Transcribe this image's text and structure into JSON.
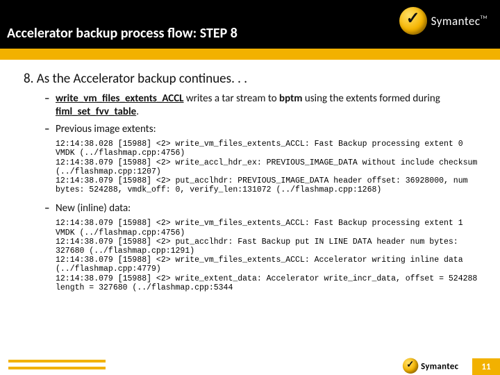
{
  "header": {
    "title": "Accelerator backup process flow: STEP 8",
    "brand": "Symantec",
    "tm": "TM"
  },
  "content": {
    "heading_no": "8.",
    "heading_txt": "As the Accelerator backup continues. . .",
    "b1_code1": "write_vm_files_extents_ACCL",
    "b1_mid1": " writes a tar stream to ",
    "b1_code2": "bptm",
    "b1_mid2": " using the extents formed during ",
    "b1_code3": "fiml_set_fvv_table",
    "b1_end": ".",
    "b2": "Previous image extents:",
    "log1": "12:14:38.028 [15988] <2> write_vm_files_extents_ACCL: Fast Backup processing extent 0 VMDK (../flashmap.cpp:4756)\n12:14:38.079 [15988] <2> write_accl_hdr_ex: PREVIOUS_IMAGE_DATA without include checksum (../flashmap.cpp:1207)\n12:14:38.079 [15988] <2> put_acclhdr: PREVIOUS_IMAGE_DATA header offset: 36928000, num bytes: 524288, vmdk_off: 0, verify_len:131072 (../flashmap.cpp:1268)",
    "b3": "New (inline) data:",
    "log2": "12:14:38.079 [15988] <2> write_vm_files_extents_ACCL: Fast Backup processing extent 1 VMDK (../flashmap.cpp:4756)\n12:14:38.079 [15988] <2> put_acclhdr: Fast Backup put IN LINE DATA header num bytes: 327680 (../flashmap.cpp:1291)\n12:14:38.079 [15988] <2> write_vm_files_extents_ACCL: Accelerator writing inline data (../flashmap.cpp:4779)\n12:14:38.079 [15988] <2> write_extent_data: Accelerator write_incr_data, offset = 524288 length = 327680 (../flashmap.cpp:5344"
  },
  "footer": {
    "brand": "Symantec",
    "page": "11"
  }
}
